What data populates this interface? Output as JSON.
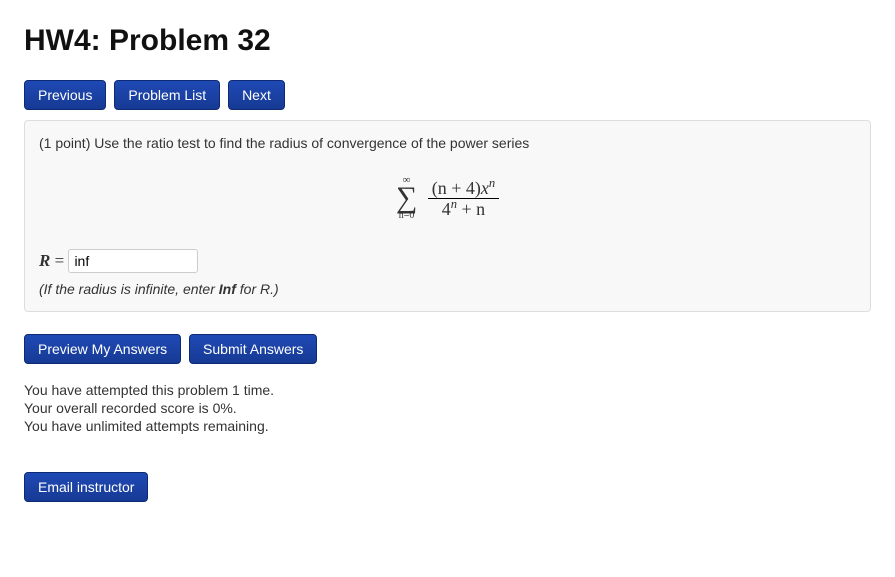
{
  "title": "HW4: Problem 32",
  "nav": {
    "previous": "Previous",
    "problem_list": "Problem List",
    "next": "Next"
  },
  "problem": {
    "prompt": "(1 point) Use the ratio test to find the radius of convergence of the power series",
    "sum_upper": "∞",
    "sum_lower": "n=0",
    "frac_num_a": "(n + 4)",
    "frac_num_b": "x",
    "frac_num_exp": "n",
    "frac_den_a": "4",
    "frac_den_exp": "n",
    "frac_den_b": " + n",
    "answer_var": "R",
    "answer_eq": " = ",
    "answer_value": "inf",
    "hint_prefix": "(If the radius is infinite, enter ",
    "hint_bold": "Inf",
    "hint_suffix": " for R.)"
  },
  "actions": {
    "preview": "Preview My Answers",
    "submit": "Submit Answers"
  },
  "status": {
    "attempted": "You have attempted this problem 1 time.",
    "score": "Your overall recorded score is 0%.",
    "remaining": "You have unlimited attempts remaining."
  },
  "email": {
    "label": "Email instructor"
  }
}
